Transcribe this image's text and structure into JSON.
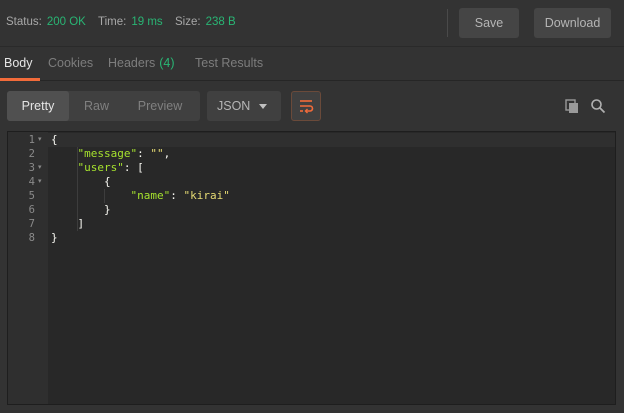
{
  "status": {
    "status_label": "Status:",
    "status_value": "200 OK",
    "time_label": "Time:",
    "time_value": "19 ms",
    "size_label": "Size:",
    "size_value": "238 B"
  },
  "actions": {
    "save_label": "Save",
    "download_label": "Download"
  },
  "tabs": [
    {
      "label": "Body",
      "active": true
    },
    {
      "label": "Cookies"
    },
    {
      "label": "Headers",
      "count": "(4)"
    },
    {
      "label": "Test Results"
    }
  ],
  "toolbar": {
    "modes": [
      "Pretty",
      "Raw",
      "Preview"
    ],
    "active_mode": "Pretty",
    "format_value": "JSON"
  },
  "icons": {
    "wrap": "wrap-lines-icon",
    "copy": "copy-icon",
    "search": "search-icon"
  },
  "editor": {
    "line_numbers": [
      "1",
      "2",
      "3",
      "4",
      "5",
      "6",
      "7",
      "8"
    ],
    "lines": [
      [
        {
          "t": "pun",
          "v": "{"
        }
      ],
      [
        {
          "t": "pun",
          "v": "    "
        },
        {
          "t": "key",
          "v": "\"message\""
        },
        {
          "t": "pun",
          "v": ": "
        },
        {
          "t": "str",
          "v": "\"\""
        },
        {
          "t": "pun",
          "v": ","
        }
      ],
      [
        {
          "t": "pun",
          "v": "    "
        },
        {
          "t": "key",
          "v": "\"users\""
        },
        {
          "t": "pun",
          "v": ": ["
        }
      ],
      [
        {
          "t": "pun",
          "v": "        {"
        }
      ],
      [
        {
          "t": "pun",
          "v": "            "
        },
        {
          "t": "key",
          "v": "\"name\""
        },
        {
          "t": "pun",
          "v": ": "
        },
        {
          "t": "str",
          "v": "\"kirai\""
        }
      ],
      [
        {
          "t": "pun",
          "v": "        }"
        }
      ],
      [
        {
          "t": "pun",
          "v": "    ]"
        }
      ],
      [
        {
          "t": "pun",
          "v": "}"
        }
      ]
    ],
    "foldable_lines": [
      1,
      3,
      4
    ]
  },
  "colors": {
    "accent": "#f26b3a",
    "status_green": "#29b574",
    "json_key": "#a6e22e",
    "json_string": "#e6db74"
  }
}
